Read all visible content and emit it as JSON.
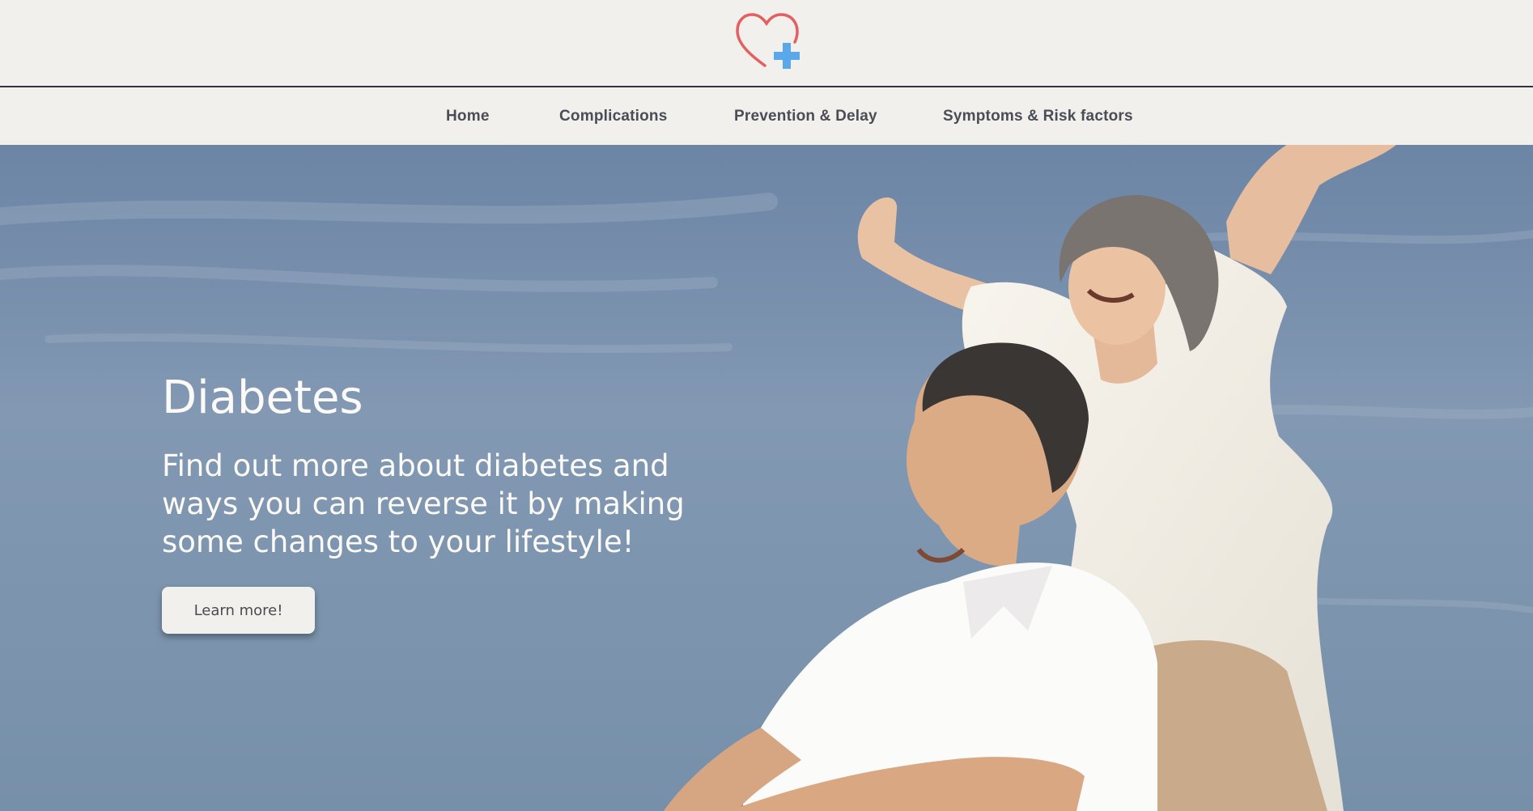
{
  "brand": {
    "logo_icon": "heart-plus-icon",
    "colors": {
      "heart": "#e45f5f",
      "cross": "#5aa7ea"
    }
  },
  "nav": {
    "items": [
      {
        "label": "Home"
      },
      {
        "label": "Complications"
      },
      {
        "label": "Prevention & Delay"
      },
      {
        "label": "Symptoms & Risk factors"
      }
    ]
  },
  "hero": {
    "title": "Diabetes",
    "description_lines": [
      "Find out more about diabetes and",
      "ways you can reverse it by making",
      "some changes to your lifestyle!"
    ],
    "button_label": "Learn more!"
  },
  "colors": {
    "header_bg": "#f1f0ec",
    "nav_text": "#4a4d57",
    "hero_sky": "#7f96b1"
  }
}
